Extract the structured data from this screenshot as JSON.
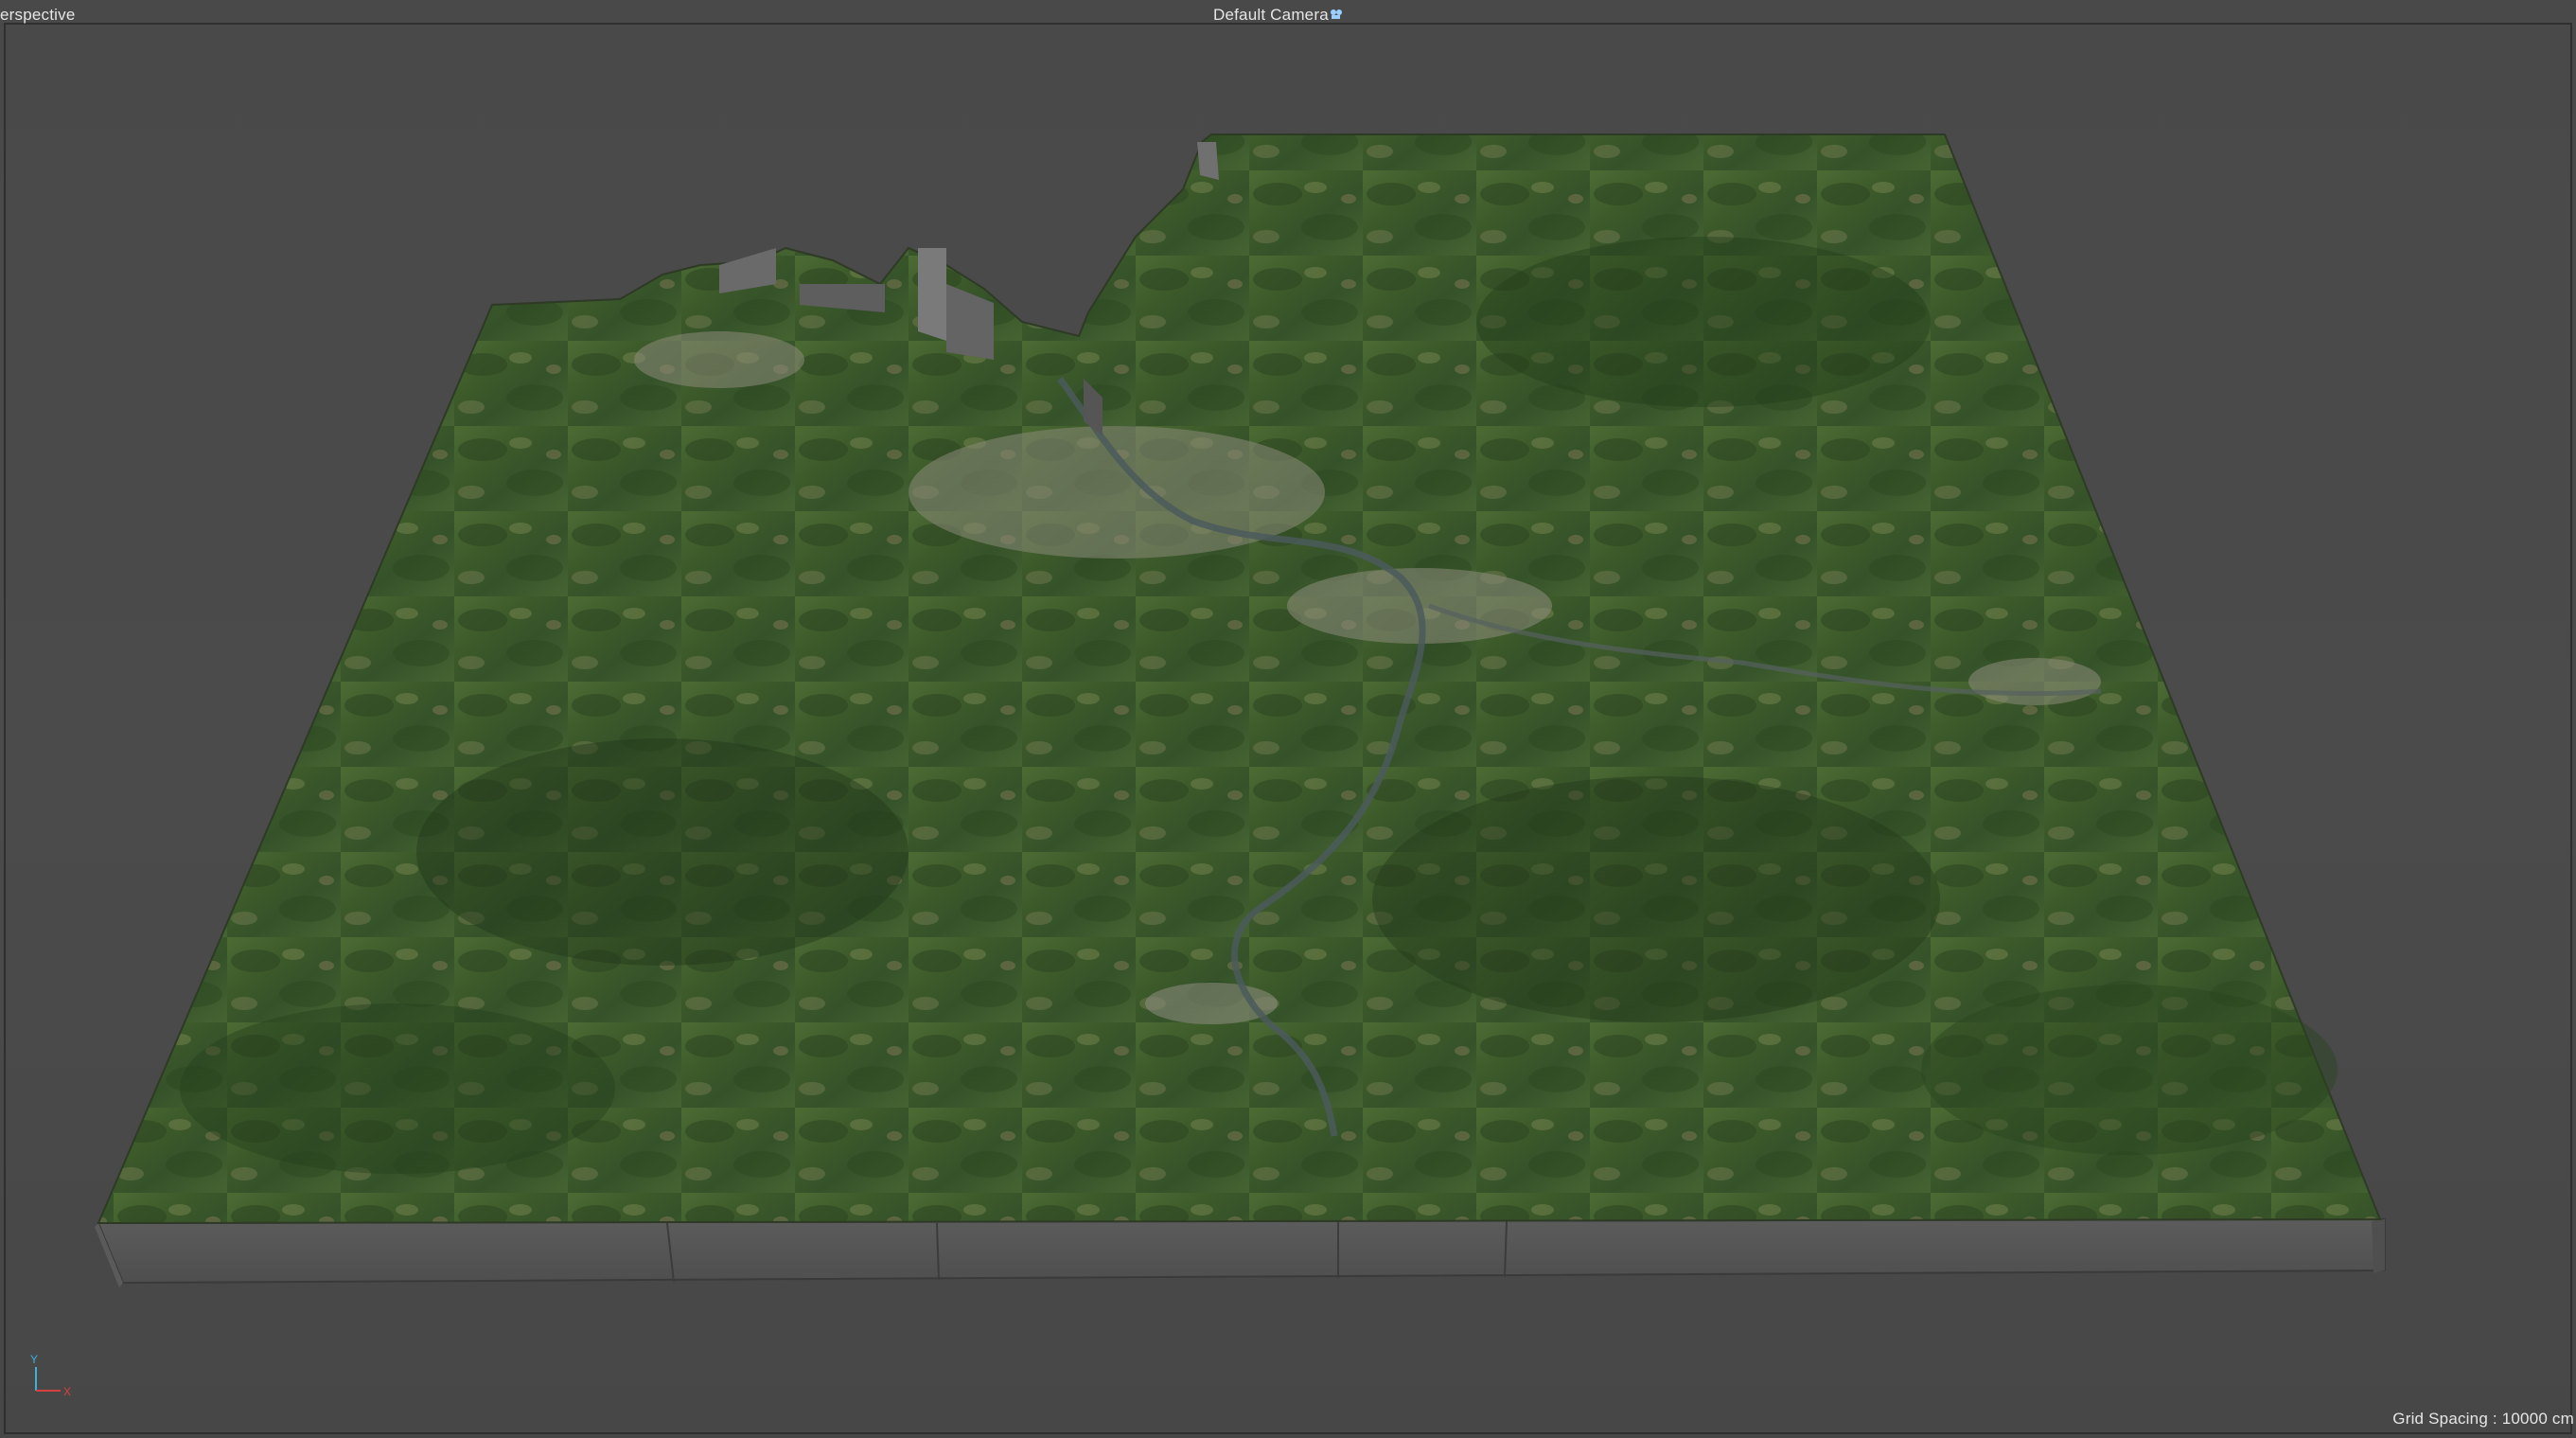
{
  "viewport": {
    "view_name": "erspective",
    "camera_label": "Default Camera",
    "camera_icon": "camera-icon",
    "grid_spacing": "Grid Spacing : 10000 cm"
  },
  "axis_gizmo": {
    "y_label": "Y",
    "x_label": "X",
    "y_color": "#3fb0d8",
    "x_color": "#d83f3f"
  },
  "colors": {
    "background": "#4a4a4a",
    "terrain_green": "#3f5e2a",
    "terrain_dark": "#2b4420",
    "slab_side": "#565656"
  }
}
